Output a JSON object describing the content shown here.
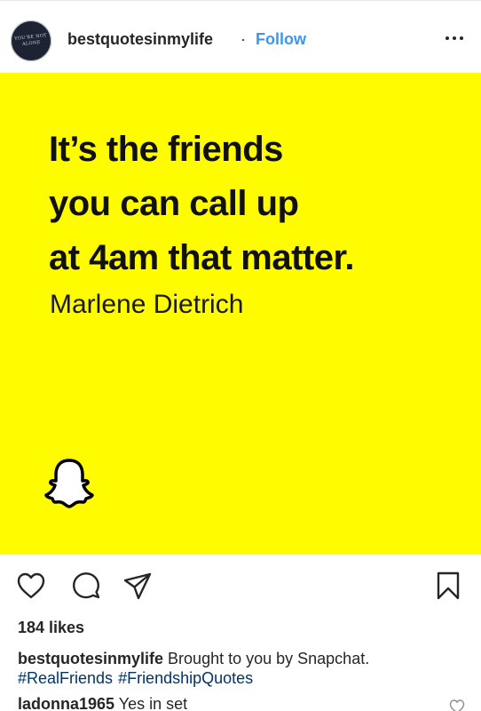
{
  "header": {
    "avatar_text": "YOU'RE NOT ALONE",
    "username": "bestquotesinmylife",
    "separator": "·",
    "follow_label": "Follow"
  },
  "post": {
    "background_color": "#fffc00",
    "quote_lines": [
      "It’s the friends",
      "you can call up",
      "at 4am that matter."
    ],
    "author": "Marlene Dietrich",
    "logo_icon": "snapchat-ghost-icon"
  },
  "actions": {
    "icons": [
      "heart-icon",
      "comment-icon",
      "share-icon",
      "bookmark-icon"
    ]
  },
  "likes": "184 likes",
  "caption": {
    "user": "bestquotesinmylife",
    "text": "Brought to you by Snapchat.",
    "hashtags": [
      "#RealFriends",
      "#FriendshipQuotes"
    ]
  },
  "comment": {
    "user": "ladonna1965",
    "text": "Yes in set"
  },
  "colors": {
    "link": "#3897f0",
    "hashtag": "#003569",
    "text": "#262626"
  }
}
